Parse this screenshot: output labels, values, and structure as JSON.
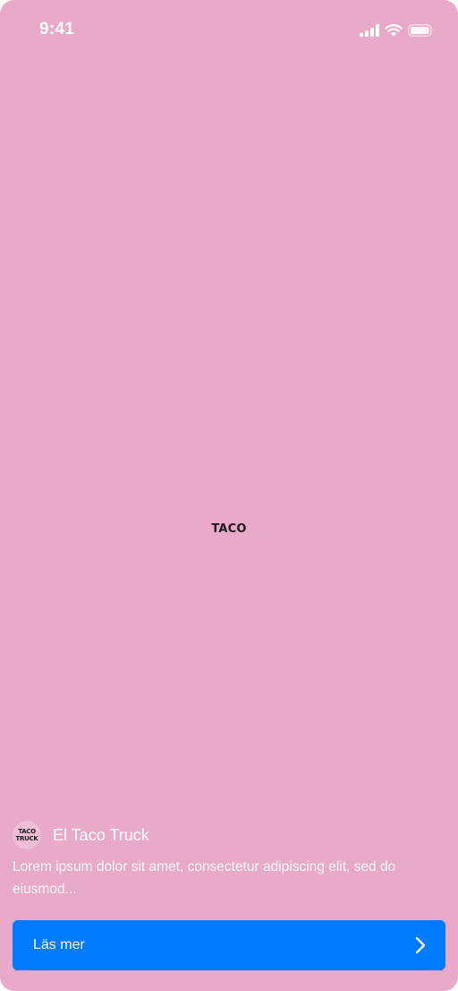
{
  "status_bar": {
    "time": "9:41",
    "icons": [
      "signal-icon",
      "wifi-icon",
      "battery-icon"
    ]
  },
  "hero": {
    "logo_text": "TACO"
  },
  "brand": {
    "avatar_line1": "TACO",
    "avatar_line2": "TRUCK",
    "name": "El Taco Truck"
  },
  "description": "Lorem ipsum dolor sit amet, consectetur adipiscing elit, sed do eiusmod...",
  "cta": {
    "label": "Läs mer",
    "icon": "chevron-right-icon"
  },
  "colors": {
    "background": "#e9a9c9",
    "button": "#007aff",
    "text": "#ffffff"
  }
}
